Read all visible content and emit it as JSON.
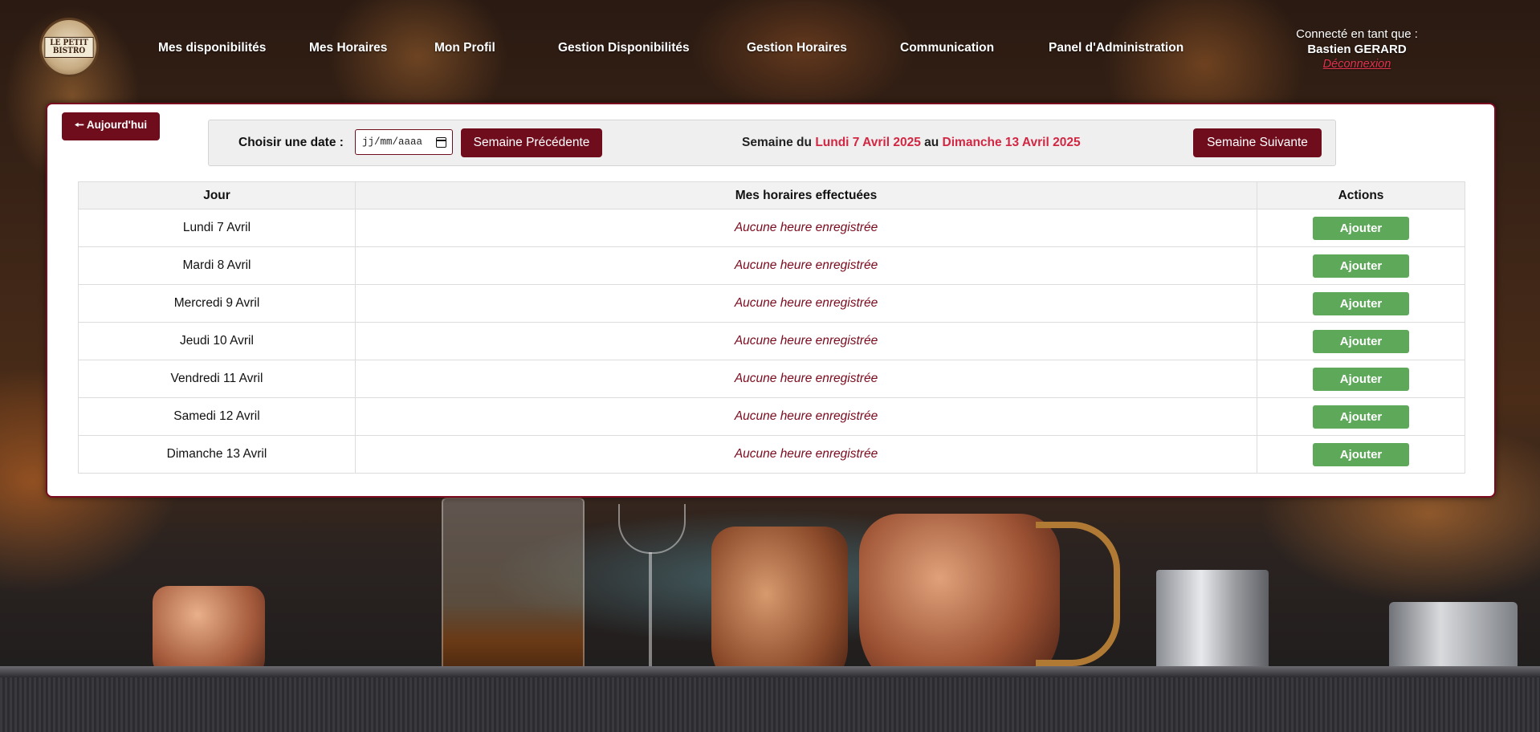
{
  "header": {
    "logo_text": "LE PETIT BISTRO",
    "nav": [
      {
        "label": "Mes disponibilités"
      },
      {
        "label": "Mes Horaires"
      },
      {
        "label": "Mon Profil"
      },
      {
        "label": "Gestion Disponibilités"
      },
      {
        "label": "Gestion Horaires"
      },
      {
        "label": "Communication"
      },
      {
        "label": "Panel d'Administration"
      }
    ],
    "user": {
      "connected_label": "Connecté en tant que :",
      "name": "Bastien GERARD",
      "logout_label": "Déconnexion"
    }
  },
  "toolbar": {
    "today_label": "🠔 Aujourd'hui",
    "date_label": "Choisir une date :",
    "date_placeholder": "jj/mm/aaaa",
    "prev_label": "Semaine Précédente",
    "next_label": "Semaine Suivante",
    "week": {
      "prefix": "Semaine du",
      "start": "Lundi 7 Avril 2025",
      "middle": "au",
      "end": "Dimanche 13 Avril 2025"
    }
  },
  "table": {
    "headers": [
      "Jour",
      "Mes horaires effectuées",
      "Actions"
    ],
    "rows": [
      {
        "day": "Lundi 7 Avril",
        "hours": "Aucune heure enregistrée",
        "action": "Ajouter"
      },
      {
        "day": "Mardi 8 Avril",
        "hours": "Aucune heure enregistrée",
        "action": "Ajouter"
      },
      {
        "day": "Mercredi 9 Avril",
        "hours": "Aucune heure enregistrée",
        "action": "Ajouter"
      },
      {
        "day": "Jeudi 10 Avril",
        "hours": "Aucune heure enregistrée",
        "action": "Ajouter"
      },
      {
        "day": "Vendredi 11 Avril",
        "hours": "Aucune heure enregistrée",
        "action": "Ajouter"
      },
      {
        "day": "Samedi 12 Avril",
        "hours": "Aucune heure enregistrée",
        "action": "Ajouter"
      },
      {
        "day": "Dimanche 13 Avril",
        "hours": "Aucune heure enregistrée",
        "action": "Ajouter"
      }
    ]
  },
  "colors": {
    "brand": "#6f0d1d",
    "accent_red": "#d22743",
    "add_button": "#5ea85a"
  }
}
